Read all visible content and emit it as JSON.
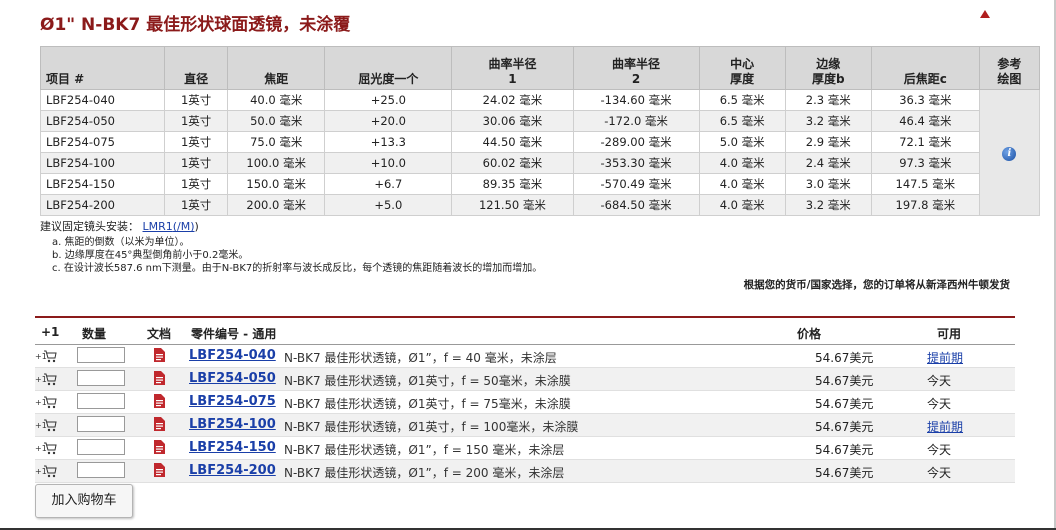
{
  "title": "Ø1\" N-BK7 最佳形状球面透镜，未涂覆",
  "spec_table": {
    "headers": {
      "item": "项目 #",
      "diameter": "直径",
      "focal": "焦距",
      "power": "屈光度一个",
      "r1": [
        "曲率半径",
        "1"
      ],
      "r2": [
        "曲率半径",
        "2"
      ],
      "center": [
        "中心",
        "厚度"
      ],
      "edge": [
        "边缘",
        "厚度b"
      ],
      "back_focal": "后焦距c",
      "ref": [
        "参考",
        "绘图"
      ]
    },
    "rows": [
      {
        "item": "LBF254-040",
        "dia": "1英寸",
        "f": "40.0 毫米",
        "power": "+25.0",
        "r1": "24.02 毫米",
        "r2": "-134.60 毫米",
        "tc": "6.5 毫米",
        "te": "2.3 毫米",
        "bfl": "36.3 毫米"
      },
      {
        "item": "LBF254-050",
        "dia": "1英寸",
        "f": "50.0 毫米",
        "power": "+20.0",
        "r1": "30.06 毫米",
        "r2": "-172.0 毫米",
        "tc": "6.5 毫米",
        "te": "3.2 毫米",
        "bfl": "46.4 毫米"
      },
      {
        "item": "LBF254-075",
        "dia": "1英寸",
        "f": "75.0 毫米",
        "power": "+13.3",
        "r1": "44.50 毫米",
        "r2": "-289.00 毫米",
        "tc": "5.0 毫米",
        "te": "2.9 毫米",
        "bfl": "72.1 毫米"
      },
      {
        "item": "LBF254-100",
        "dia": "1英寸",
        "f": "100.0 毫米",
        "power": "+10.0",
        "r1": "60.02 毫米",
        "r2": "-353.30 毫米",
        "tc": "4.0 毫米",
        "te": "2.4 毫米",
        "bfl": "97.3 毫米"
      },
      {
        "item": "LBF254-150",
        "dia": "1英寸",
        "f": "150.0 毫米",
        "power": "+6.7",
        "r1": "89.35 毫米",
        "r2": "-570.49 毫米",
        "tc": "4.0 毫米",
        "te": "3.0 毫米",
        "bfl": "147.5 毫米"
      },
      {
        "item": "LBF254-200",
        "dia": "1英寸",
        "f": "200.0 毫米",
        "power": "+5.0",
        "r1": "121.50 毫米",
        "r2": "-684.50 毫米",
        "tc": "4.0 毫米",
        "te": "3.2 毫米",
        "bfl": "197.8 毫米"
      }
    ],
    "ref_icon": "i"
  },
  "mount": {
    "label": "建议固定镜头安装：",
    "link1": "LMR1",
    "link2": "(/M)",
    "close": ")"
  },
  "footnotes": [
    "a. 焦距的倒数（以米为单位）。",
    "b. 边缘厚度在45°典型倒角前小于0.2毫米。",
    "c. 在设计波长587.6 nm下测量。由于N-BK7的折射率与波长成反比，每个透镜的焦距随着波长的增加而增加。"
  ],
  "ship_note": "根据您的货币/国家选择，您的订单将从新泽西州牛顿发货",
  "order": {
    "headers": {
      "plus": "+1",
      "qty": "数量",
      "docs": "文档",
      "part": "零件编号 - 通用",
      "price": "价格",
      "avail": "可用"
    },
    "rows": [
      {
        "part": "LBF254-040",
        "desc": "N-BK7 最佳形状透镜，Ø1”，f = 40 毫米，未涂层",
        "price": "54.67美元",
        "avail": "提前期",
        "avail_link": true
      },
      {
        "part": "LBF254-050",
        "desc": "N-BK7 最佳形状透镜，Ø1英寸，f = 50毫米，未涂膜",
        "price": "54.67美元",
        "avail": "今天",
        "avail_link": false
      },
      {
        "part": "LBF254-075",
        "desc": "N-BK7 最佳形状透镜，Ø1英寸，f = 75毫米，未涂膜",
        "price": "54.67美元",
        "avail": "今天",
        "avail_link": false
      },
      {
        "part": "LBF254-100",
        "desc": "N-BK7 最佳形状透镜，Ø1英寸，f = 100毫米，未涂膜",
        "price": "54.67美元",
        "avail": "提前期",
        "avail_link": true
      },
      {
        "part": "LBF254-150",
        "desc": "N-BK7 最佳形状透镜，Ø1”，f = 150 毫米，未涂层",
        "price": "54.67美元",
        "avail": "今天",
        "avail_link": false
      },
      {
        "part": "LBF254-200",
        "desc": "N-BK7 最佳形状透镜，Ø1”，f = 200 毫米，未涂层",
        "price": "54.67美元",
        "avail": "今天",
        "avail_link": false
      }
    ],
    "add_to_cart": "加入购物车"
  },
  "colors": {
    "title": "#8b1a1a",
    "link": "#1a3fa8",
    "header_bg": "#d8d8d8",
    "doc_icon": "#c0282d"
  }
}
